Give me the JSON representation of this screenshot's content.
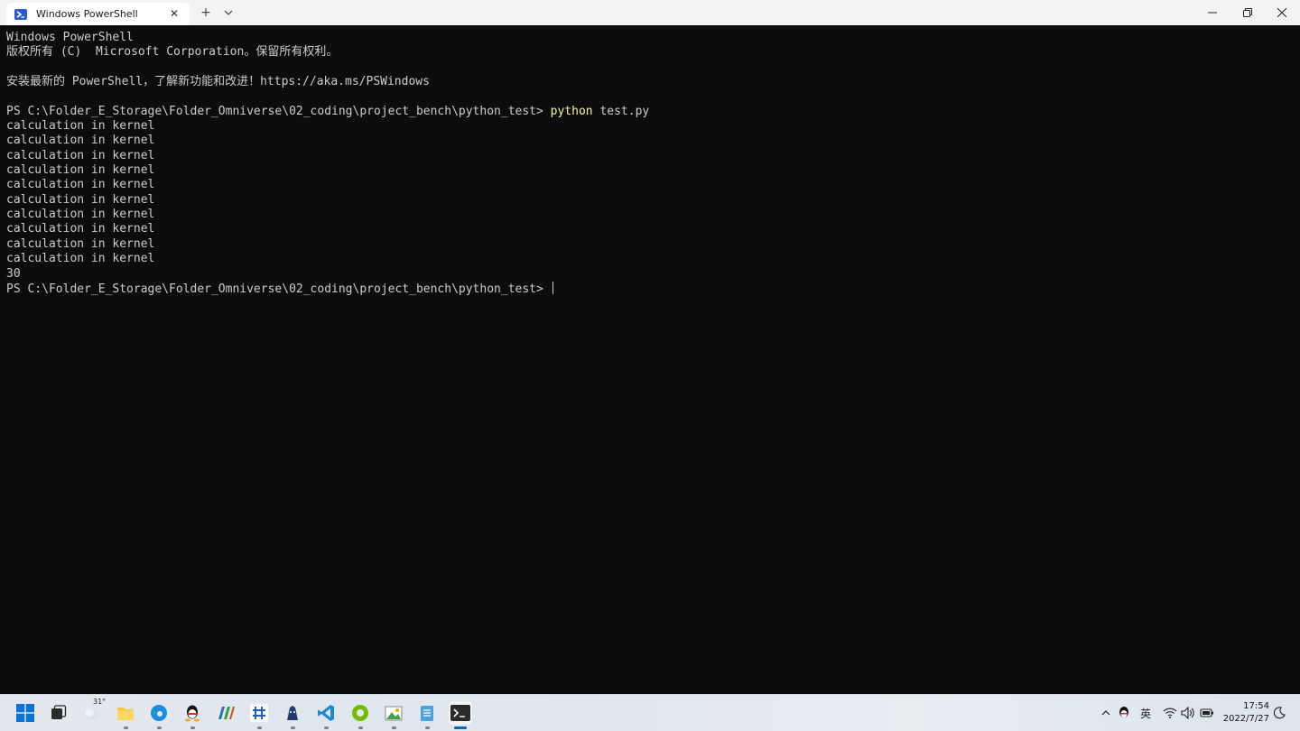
{
  "window": {
    "tab_title": "Windows PowerShell",
    "tab_close": "✕",
    "new_tab": "+",
    "colors": {
      "terminal_bg": "#0c0c0c",
      "terminal_text": "#cccccc",
      "command_highlight": "#f9f1a5",
      "powershell_icon": "#2a5bd7"
    }
  },
  "terminal": {
    "lines": [
      "Windows PowerShell",
      "版权所有 (C)  Microsoft Corporation。保留所有权利。",
      "",
      "安装最新的 PowerShell，了解新功能和改进！https://aka.ms/PSWindows",
      ""
    ],
    "prompt": "PS C:\\Folder_E_Storage\\Folder_Omniverse\\02_coding\\project_bench\\python_test> ",
    "command_name": "python",
    "command_args": " test.py",
    "output": [
      "calculation in kernel",
      "calculation in kernel",
      "calculation in kernel",
      "calculation in kernel",
      "calculation in kernel",
      "calculation in kernel",
      "calculation in kernel",
      "calculation in kernel",
      "calculation in kernel",
      "calculation in kernel",
      "30"
    ]
  },
  "taskbar": {
    "weather_temp": "31°",
    "language": "英",
    "time": "17:54",
    "date": "2022/7/27",
    "icons": [
      "windows-start-icon",
      "task-view-icon",
      "weather-icon",
      "file-explorer-icon",
      "edge-icon",
      "qq-icon",
      "matlab-icon",
      "app-icon",
      "pycharm-icon",
      "vscode-icon",
      "omniverse-icon",
      "photo-icon",
      "notepad-icon",
      "terminal-icon"
    ]
  }
}
